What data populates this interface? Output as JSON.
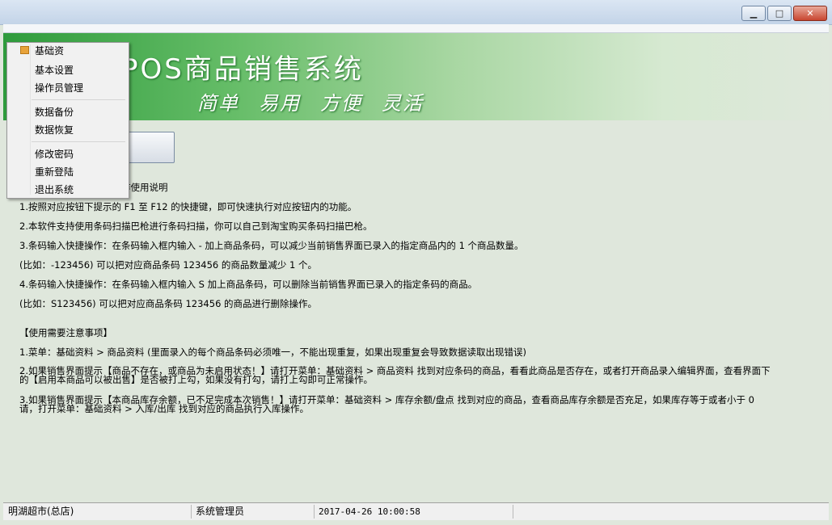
{
  "banner": {
    "title": "POS商品销售系统",
    "slogan": [
      "简单",
      "易用",
      "方便",
      "灵活"
    ]
  },
  "menu": {
    "open_item": "基础资",
    "items": [
      {
        "label": "基本设置"
      },
      {
        "label": "操作员管理"
      },
      {
        "label": "数据备份"
      },
      {
        "label": "数据恢复"
      },
      {
        "label": "修改密码"
      },
      {
        "label": "重新登陆"
      },
      {
        "label": "退出系统"
      }
    ]
  },
  "content": {
    "instructions_header": "作使用说明",
    "lines": [
      "1.按照对应按钮下提示的 F1 至 F12 的快捷键，即可快速执行对应按钮内的功能。",
      "2.本软件支持使用条码扫描巴枪进行条码扫描，你可以自己到淘宝购买条码扫描巴枪。",
      "3.条码输入快捷操作：在条码输入框内输入 - 加上商品条码，可以减少当前销售界面已录入的指定商品内的 1 个商品数量。",
      "(比如：-123456) 可以把对应商品条码 123456 的商品数量减少 1 个。",
      "4.条码输入快捷操作：在条码输入框内输入 S 加上商品条码，可以删除当前销售界面已录入的指定条码的商品。",
      "(比如：S123456) 可以把对应商品条码 123456 的商品进行删除操作。"
    ],
    "notes_header": "【使用需要注意事项】",
    "notes": [
      "1.菜单：基础资料 > 商品资料 (里面录入的每个商品条码必须唯一，不能出现重复，如果出现重复会导致数据读取出现错误)",
      "2.如果销售界面提示【商品不存在，或商品为未启用状态！】请打开菜单：基础资料 > 商品资料 找到对应条码的商品，看看此商品是否存在，或者打开商品录入编辑界面，查看界面下的【启用本商品可以被出售】是否被打上勾，如果没有打勾，请打上勾即可正常操作。",
      "3.如果销售界面提示【本商品库存余额，已不足完成本次销售！】请打开菜单：基础资料 > 库存余额/盘点 找到对应的商品，查看商品库存余额是否充足，如果库存等于或者小于 0 请，打开菜单：基础资料 > 入库/出库 找到对应的商品执行入库操作。"
    ]
  },
  "status": {
    "store": "明湖超市(总店)",
    "user": "系统管理员",
    "time": "2017-04-26 10:00:58"
  },
  "colors": {
    "banner_green": "#2e9b3c",
    "background": "#dfe7dc"
  }
}
